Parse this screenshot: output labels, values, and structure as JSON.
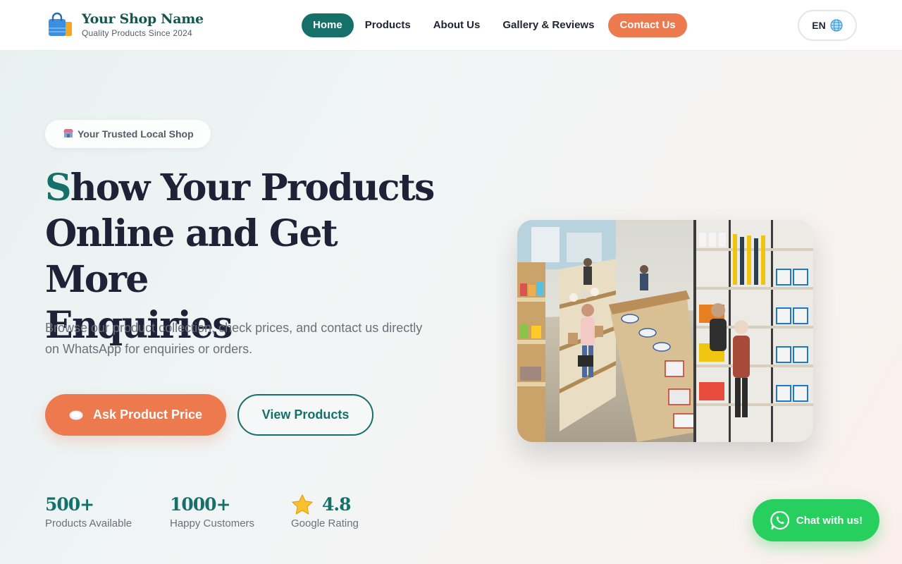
{
  "header": {
    "shop_name": "Your Shop Name",
    "tagline": "Quality Products Since 2024",
    "logo_icon": "shopping-bag-icon",
    "nav": [
      {
        "label": "Home",
        "active": true
      },
      {
        "label": "Products"
      },
      {
        "label": "About Us"
      },
      {
        "label": "Gallery & Reviews"
      },
      {
        "label": "Contact Us",
        "cta": true
      }
    ],
    "language": "EN",
    "language_icon": "globe-icon"
  },
  "hero": {
    "badge_icon": "store-icon",
    "badge_text": "Your Trusted Local Shop",
    "headline_first_letter": "S",
    "headline_line1_rest": "how Your Products",
    "headline_line2": "Online and Get More",
    "headline_line3": "Enquiries",
    "subtext": "Browse our product collection, check prices, and contact us directly on WhatsApp for enquiries or orders.",
    "primary_button": "Ask Product Price",
    "primary_button_icon": "chat-bubble-icon",
    "secondary_button": "View Products",
    "image_icon": "shop-interior-photo"
  },
  "stats": [
    {
      "value": "500+",
      "label": "Products Available"
    },
    {
      "value": "1000+",
      "label": "Happy Customers"
    },
    {
      "value": "4.8",
      "label": "Google Rating",
      "icon": "star-icon"
    }
  ],
  "whatsapp": {
    "label": "Chat with us!",
    "icon": "whatsapp-icon"
  },
  "colors": {
    "primary": "#16706a",
    "accent": "#ec7a4e",
    "whatsapp": "#27cf5f",
    "heading": "#1e2236"
  }
}
